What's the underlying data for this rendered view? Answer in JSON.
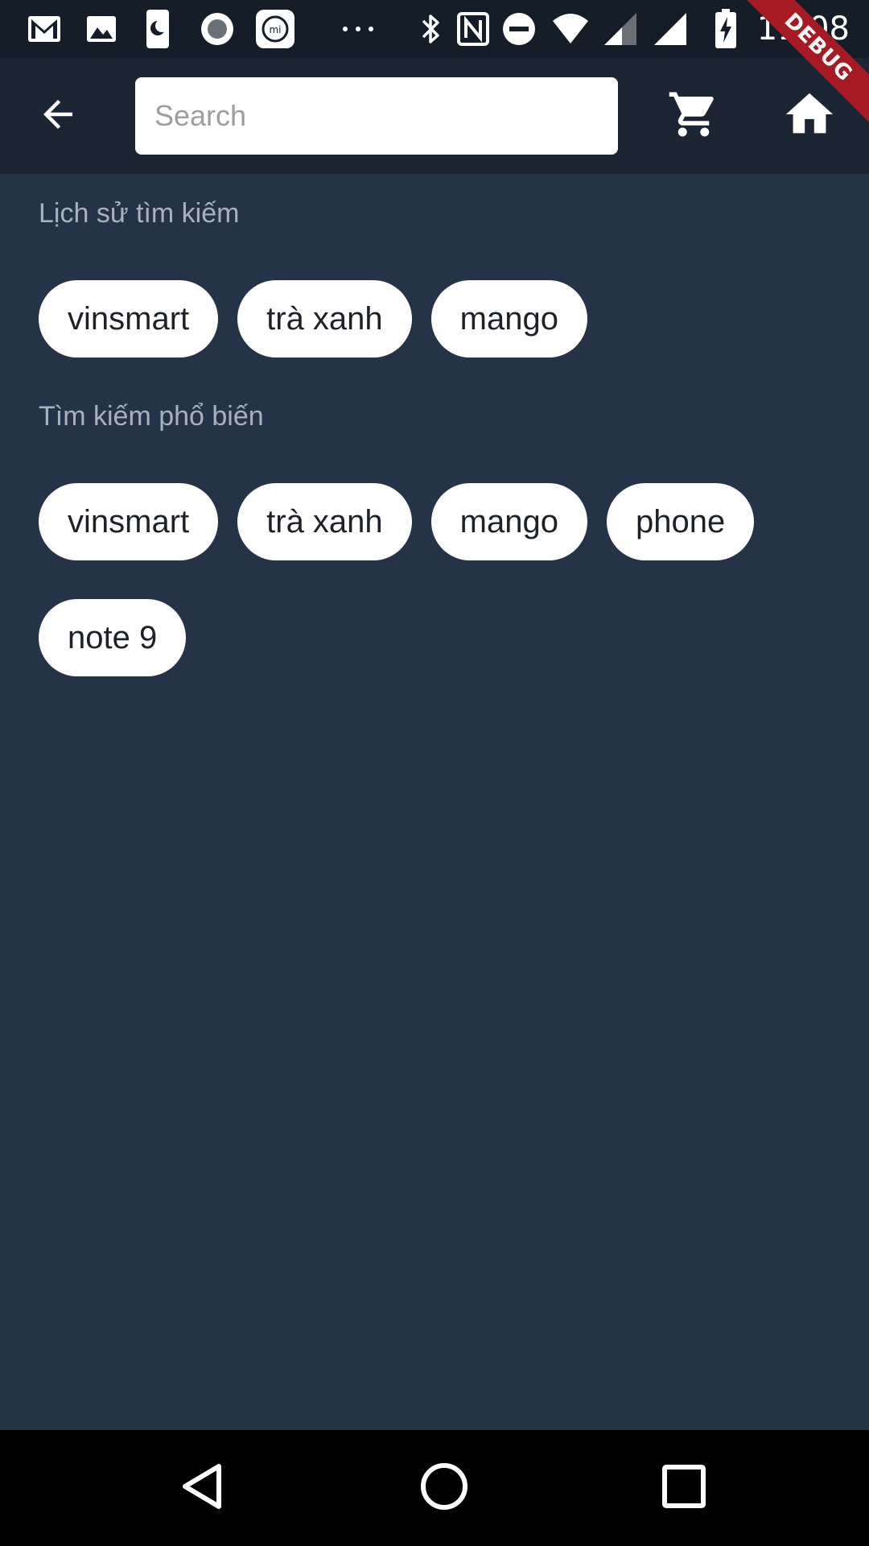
{
  "status_bar": {
    "time": "11:08",
    "left_icons": [
      "gmail-icon",
      "gallery-icon",
      "moon-icon",
      "record-icon",
      "mi-icon",
      "more-dots-icon"
    ],
    "right_icons": [
      "bluetooth-icon",
      "nfc-icon",
      "dnd-icon",
      "wifi-icon",
      "signal-icon",
      "signal-icon",
      "battery-charging-icon"
    ]
  },
  "debug_banner": "DEBUG",
  "app_bar": {
    "back_icon": "arrow-back-icon",
    "search_placeholder": "Search",
    "search_value": "",
    "cart_icon": "cart-icon",
    "home_icon": "home-icon"
  },
  "history": {
    "title": "Lịch sử tìm kiếm",
    "chips": [
      "vinsmart",
      "trà xanh",
      "mango"
    ]
  },
  "popular": {
    "title": "Tìm kiếm phổ biến",
    "chips": [
      "vinsmart",
      "trà xanh",
      "mango",
      "phone",
      "note 9"
    ]
  },
  "nav_bar": {
    "icons": [
      "back-triangle-icon",
      "home-circle-icon",
      "recents-square-icon"
    ]
  },
  "colors": {
    "background": "#243347",
    "app_bar": "#1b2533",
    "status_bar": "#151d28",
    "chip_background": "#ffffff",
    "section_title": "#a9b1bd",
    "debug_ribbon": "#a71a24"
  }
}
